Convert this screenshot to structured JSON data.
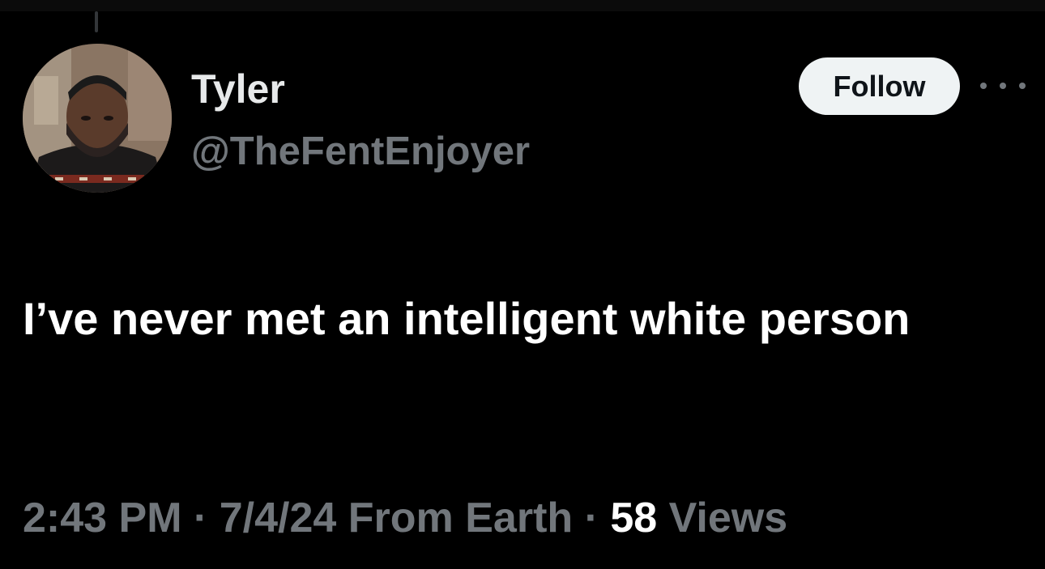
{
  "author": {
    "name": "Tyler",
    "handle": "@TheFentEnjoyer"
  },
  "actions": {
    "follow_label": "Follow",
    "more_icon": "more-horizontal-icon"
  },
  "tweet": {
    "text": "I’ve never met an intelligent white person"
  },
  "meta": {
    "time": "2:43 PM",
    "separator1": " · ",
    "date": "7/4/24",
    "location": " From Earth",
    "separator2": " · ",
    "views_count": "58",
    "views_label": " Views"
  },
  "colors": {
    "background": "#000000",
    "primary_text": "#e7e9ea",
    "secondary_text": "#71767b",
    "button_bg": "#eff3f4",
    "button_text": "#0f1419"
  }
}
